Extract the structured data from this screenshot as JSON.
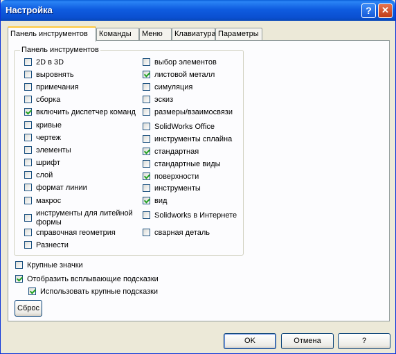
{
  "window": {
    "title": "Настройка",
    "help_glyph": "?",
    "close_glyph": "✕"
  },
  "tabs": [
    {
      "label": "Панель инструментов",
      "active": true
    },
    {
      "label": "Команды",
      "active": false
    },
    {
      "label": "Меню",
      "active": false
    },
    {
      "label": "Клавиатура",
      "active": false
    },
    {
      "label": "Параметры",
      "active": false
    }
  ],
  "group": {
    "legend": "Панель инструментов",
    "left": [
      {
        "label": "2D в 3D",
        "checked": false
      },
      {
        "label": "выровнять",
        "checked": false
      },
      {
        "label": "примечания",
        "checked": false
      },
      {
        "label": "сборка",
        "checked": false
      },
      {
        "label": "включить диспетчер команд",
        "checked": true
      },
      {
        "label": "кривые",
        "checked": false
      },
      {
        "label": "чертеж",
        "checked": false
      },
      {
        "label": "элементы",
        "checked": false
      },
      {
        "label": "шрифт",
        "checked": false
      },
      {
        "label": "слой",
        "checked": false
      },
      {
        "label": "формат линии",
        "checked": false
      },
      {
        "label": "макрос",
        "checked": false
      },
      {
        "label": "инструменты для литейной формы",
        "checked": false
      },
      {
        "label": "справочная геометрия",
        "checked": false
      },
      {
        "label": "Разнести",
        "checked": false
      }
    ],
    "right": [
      {
        "label": "выбор элементов",
        "checked": false
      },
      {
        "label": "листовой металл",
        "checked": true
      },
      {
        "label": "симуляция",
        "checked": false
      },
      {
        "label": "эскиз",
        "checked": false
      },
      {
        "label": "размеры/взаимосвязи",
        "checked": false
      },
      {
        "label": "SolidWorks Office",
        "checked": false
      },
      {
        "label": "инструменты сплайна",
        "checked": false
      },
      {
        "label": "стандартная",
        "checked": true
      },
      {
        "label": "стандартные виды",
        "checked": false
      },
      {
        "label": "поверхности",
        "checked": true
      },
      {
        "label": "инструменты",
        "checked": false
      },
      {
        "label": "вид",
        "checked": true
      },
      {
        "label": "Solidworks в Интернете",
        "checked": false
      },
      {
        "label": "сварная деталь",
        "checked": false
      }
    ]
  },
  "options": {
    "large_icons": {
      "label": "Крупные значки",
      "checked": false
    },
    "show_tooltips": {
      "label": "Отобразить всплывающие подсказки",
      "checked": true
    },
    "large_tooltips": {
      "label": "Использовать крупные подсказки",
      "checked": true
    }
  },
  "buttons": {
    "reset": "Сброс",
    "ok": "OK",
    "cancel": "Отмена",
    "help": "?"
  }
}
